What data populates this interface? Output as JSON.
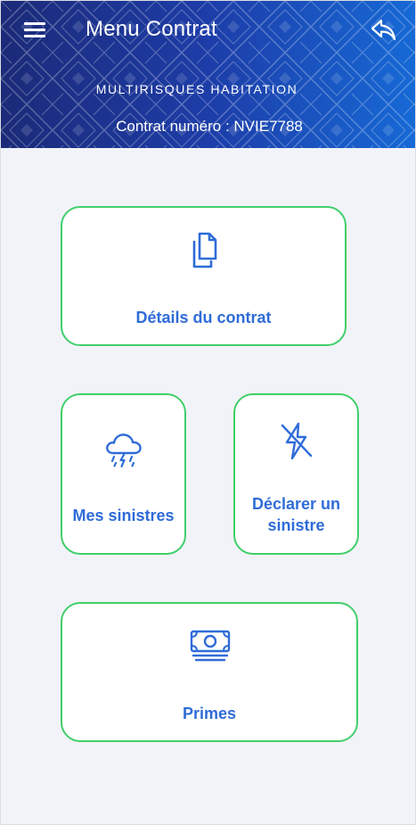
{
  "header": {
    "title": "Menu Contrat",
    "product": "MULTIRISQUES HABITATION",
    "contract_line": "Contrat numéro : NVIE7788"
  },
  "icons": {
    "menu": "hamburger-menu-icon",
    "back": "reply-arrow-icon"
  },
  "cards": {
    "details": {
      "label": "Détails du contrat",
      "icon": "documents-icon"
    },
    "sinistres": {
      "label": "Mes sinistres",
      "icon": "storm-cloud-icon"
    },
    "declarer": {
      "label_line1": "Déclarer un",
      "label_line2": "sinistre",
      "icon": "lightning-off-icon"
    },
    "primes": {
      "label": "Primes",
      "icon": "banknotes-icon"
    }
  },
  "colors": {
    "header_start": "#1b2a78",
    "header_end": "#1669d6",
    "card_border": "#3fcf6a",
    "accent_text": "#2f6cd8",
    "background": "#f2f3f8"
  }
}
